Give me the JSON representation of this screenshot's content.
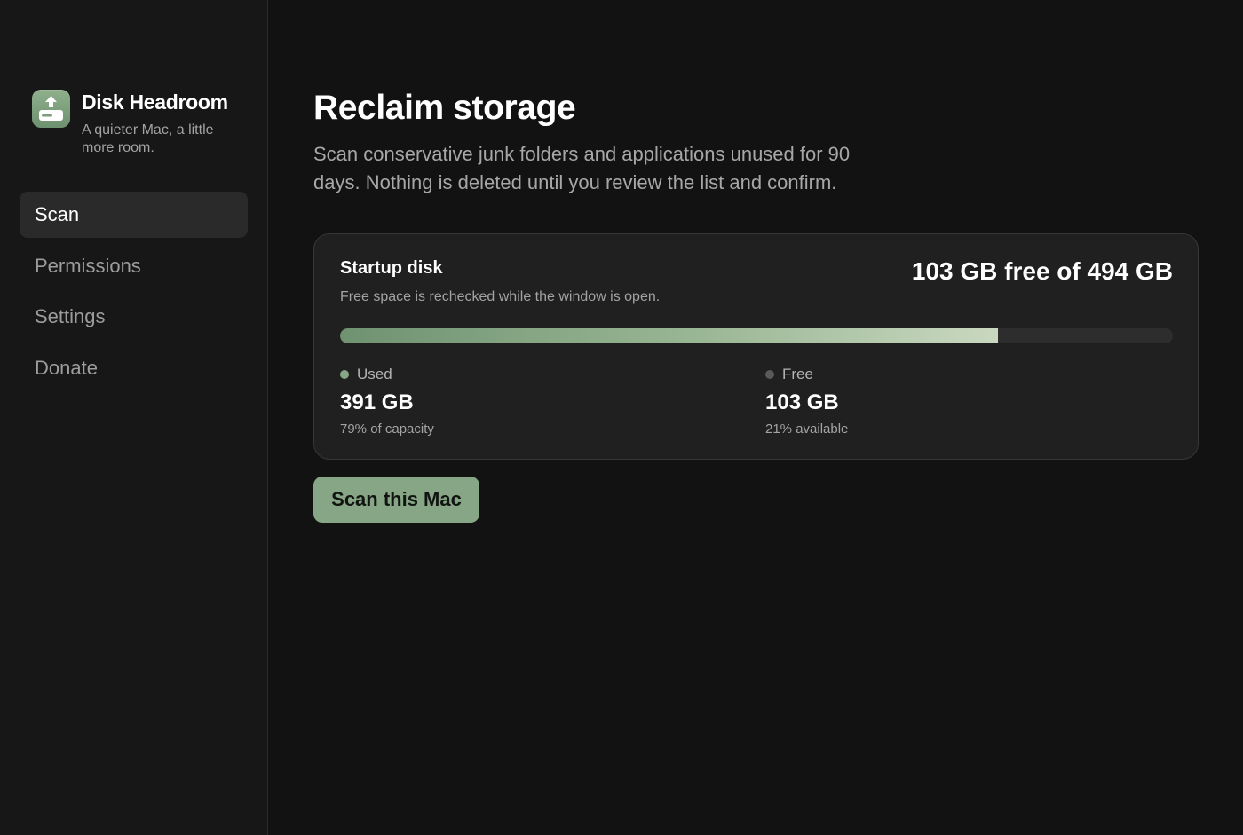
{
  "app": {
    "name": "Disk Headroom",
    "tagline": "A quieter Mac, a little more room.",
    "icon": "disk-upload-icon",
    "accent_color": "#86a685"
  },
  "sidebar": {
    "items": [
      {
        "label": "Scan",
        "active": true
      },
      {
        "label": "Permissions",
        "active": false
      },
      {
        "label": "Settings",
        "active": false
      },
      {
        "label": "Donate",
        "active": false
      }
    ]
  },
  "main": {
    "title": "Reclaim storage",
    "subtitle": "Scan conservative junk folders and applications unused for 90 days. Nothing is deleted until you review the list and confirm.",
    "disk_card": {
      "title": "Startup disk",
      "subtitle": "Free space is rechecked while the window is open.",
      "summary": "103 GB free of 494 GB",
      "used_fraction": 0.79,
      "used": {
        "label": "Used",
        "value": "391 GB",
        "note": "79% of capacity",
        "dot_color": "#86a685"
      },
      "free": {
        "label": "Free",
        "value": "103 GB",
        "note": "21% available",
        "dot_color": "#5a5a5a"
      }
    },
    "scan_button_label": "Scan this Mac"
  }
}
